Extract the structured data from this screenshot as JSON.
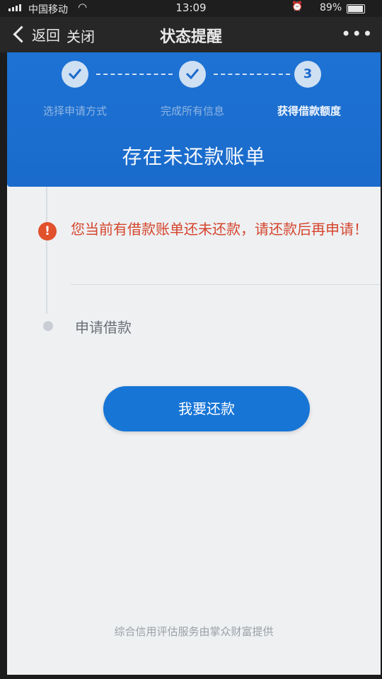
{
  "status_bar": {
    "carrier": "中国移动",
    "time": "13:09",
    "battery": "89%",
    "battery_level": 0.89
  },
  "nav": {
    "back_label": "返回",
    "close_label": "关闭",
    "title": "状态提醒",
    "more_label": "•••"
  },
  "steps": [
    {
      "label": "选择申请方式",
      "state": "done"
    },
    {
      "label": "完成所有信息",
      "state": "done"
    },
    {
      "label": "获得借款额度",
      "state": "current",
      "number": "3"
    }
  ],
  "header": {
    "title": "存在未还款账单"
  },
  "alert": {
    "text": "您当前有借款账单还未还款，请还款后再申请！"
  },
  "timeline": {
    "apply_label": "申请借款"
  },
  "actions": {
    "repay_label": "我要还款"
  },
  "footer": {
    "note": "综合信用评估服务由掌众财富提供"
  },
  "colors": {
    "header_blue": "#1d72d4",
    "button_blue": "#1775d6",
    "alert_red": "#d5452c"
  }
}
